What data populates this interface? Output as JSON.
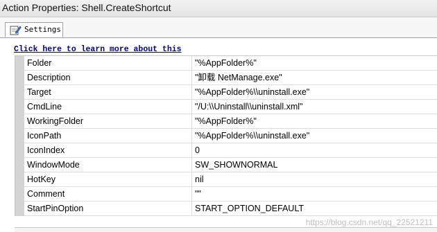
{
  "window": {
    "title": "Action Properties: Shell.CreateShortcut"
  },
  "tabs": [
    {
      "label": "Settings",
      "icon": "edit-icon"
    }
  ],
  "link": {
    "text": "Click here to learn more about this "
  },
  "properties": [
    {
      "name": "Folder",
      "value": "\"%AppFolder%\""
    },
    {
      "name": "Description",
      "value": "\"卸载 NetManage.exe\""
    },
    {
      "name": "Target",
      "value": "\"%AppFolder%\\\\uninstall.exe\""
    },
    {
      "name": "CmdLine",
      "value": "\"/U:\\\\Uninstall\\\\uninstall.xml\""
    },
    {
      "name": "WorkingFolder",
      "value": "\"%AppFolder%\""
    },
    {
      "name": "IconPath",
      "value": "\"%AppFolder%\\\\uninstall.exe\""
    },
    {
      "name": "IconIndex",
      "value": "0"
    },
    {
      "name": "WindowMode",
      "value": "SW_SHOWNORMAL"
    },
    {
      "name": "HotKey",
      "value": "nil"
    },
    {
      "name": "Comment",
      "value": "\"\""
    },
    {
      "name": "StartPinOption",
      "value": "START_OPTION_DEFAULT"
    }
  ],
  "watermark": "https://blog.csdn.net/qq_22521211"
}
